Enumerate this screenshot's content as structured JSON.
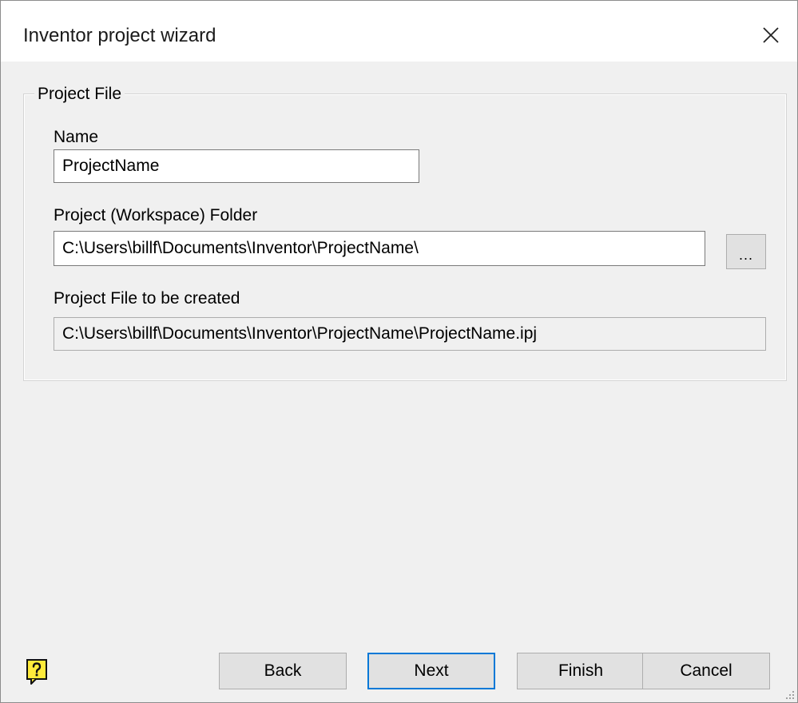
{
  "window": {
    "title": "Inventor project wizard",
    "close_icon": "close-icon"
  },
  "group": {
    "legend": "Project File"
  },
  "name_field": {
    "label": "Name",
    "value": "ProjectName"
  },
  "folder_field": {
    "label": "Project (Workspace) Folder",
    "value": "C:\\Users\\billf\\Documents\\Inventor\\ProjectName\\",
    "browse_label": "..."
  },
  "file_field": {
    "label": "Project File to be created",
    "value": "C:\\Users\\billf\\Documents\\Inventor\\ProjectName\\ProjectName.ipj"
  },
  "footer": {
    "help_icon": "help-icon",
    "back_label": "Back",
    "next_label": "Next",
    "finish_label": "Finish",
    "cancel_label": "Cancel"
  },
  "colors": {
    "accent": "#0078d7",
    "dialog_background": "#f0f0f0",
    "button_face": "#e1e1e1",
    "help_icon_fill": "#ffeb3b"
  }
}
